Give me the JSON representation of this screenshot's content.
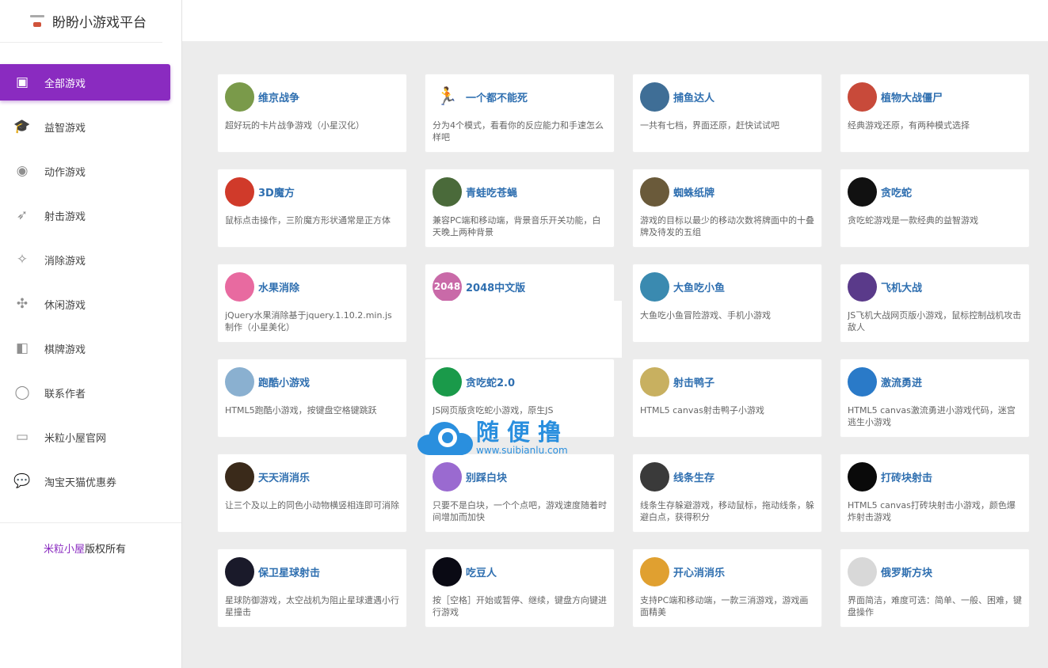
{
  "brand": {
    "title": "盼盼小游戏平台",
    "logo_icon": "site-logo-icon"
  },
  "sidebar": {
    "items": [
      {
        "label": "全部游戏",
        "icon": "twitch-icon",
        "glyph": "▣",
        "active": true
      },
      {
        "label": "益智游戏",
        "icon": "graduation-cap-icon",
        "glyph": "🎓",
        "active": false
      },
      {
        "label": "动作游戏",
        "icon": "reddit-icon",
        "glyph": "◉",
        "active": false
      },
      {
        "label": "射击游戏",
        "icon": "rocket-icon",
        "glyph": "➶",
        "active": false
      },
      {
        "label": "消除游戏",
        "icon": "puzzle-icon",
        "glyph": "✧",
        "active": false
      },
      {
        "label": "休闲游戏",
        "icon": "pinwheel-icon",
        "glyph": "✣",
        "active": false
      },
      {
        "label": "棋牌游戏",
        "icon": "grid-icon",
        "glyph": "◧",
        "active": false
      },
      {
        "label": "联系作者",
        "icon": "user-icon",
        "glyph": "◯",
        "active": false
      },
      {
        "label": "米粒小屋官网",
        "icon": "laptop-icon",
        "glyph": "▭",
        "active": false
      },
      {
        "label": "淘宝天猫优惠券",
        "icon": "chat-bubble-icon",
        "glyph": "💬",
        "active": false
      }
    ],
    "footer": {
      "link": "米粒小屋",
      "text": "版权所有"
    }
  },
  "games": [
    {
      "title": "维京战争",
      "desc": "超好玩的卡片战争游戏（小星汉化）",
      "icon_color": "#7a9a4a",
      "badge": ""
    },
    {
      "title": "一个都不能死",
      "desc": "分为4个模式，看看你的反应能力和手速怎么样吧",
      "icon_color": "#ffffff",
      "badge": ""
    },
    {
      "title": "捕鱼达人",
      "desc": "一共有七档，界面还原，赶快试试吧",
      "icon_color": "#3f6e96",
      "badge": ""
    },
    {
      "title": "植物大战僵尸",
      "desc": "经典游戏还原，有两种模式选择",
      "icon_color": "#c84a3a",
      "badge": ""
    },
    {
      "title": "3D魔方",
      "desc": "鼠标点击操作，三阶魔方形状通常是正方体",
      "icon_color": "#d03a2a",
      "badge": ""
    },
    {
      "title": "青蛙吃苍蝇",
      "desc": "兼容PC端和移动端，背景音乐开关功能，白天晚上两种背景",
      "icon_color": "#4a6a3a",
      "badge": ""
    },
    {
      "title": "蜘蛛纸牌",
      "desc": "游戏的目标以最少的移动次数将牌面中的十叠牌及待发的五组",
      "icon_color": "#6a5a3a",
      "badge": ""
    },
    {
      "title": "贪吃蛇",
      "desc": "贪吃蛇游戏是一款经典的益智游戏",
      "icon_color": "#111111",
      "badge": ""
    },
    {
      "title": "水果消除",
      "desc": "jQuery水果消除基于jquery.1.10.2.min.js制作（小星美化）",
      "icon_color": "#e86aa0",
      "badge": ""
    },
    {
      "title": "2048中文版",
      "desc": "",
      "icon_color": "#c96aa8",
      "badge": "2048"
    },
    {
      "title": "大鱼吃小鱼",
      "desc": "大鱼吃小鱼冒险游戏、手机小游戏",
      "icon_color": "#3a8ab0",
      "badge": ""
    },
    {
      "title": "飞机大战",
      "desc": "JS飞机大战网页版小游戏，鼠标控制战机攻击敌人",
      "icon_color": "#5a3a8a",
      "badge": ""
    },
    {
      "title": "跑酷小游戏",
      "desc": "HTML5跑酷小游戏，按键盘空格键跳跃",
      "icon_color": "#8ab0d0",
      "badge": ""
    },
    {
      "title": "贪吃蛇2.0",
      "desc": "JS网页版贪吃蛇小游戏，原生JS",
      "icon_color": "#1a9a4a",
      "badge": ""
    },
    {
      "title": "射击鸭子",
      "desc": "HTML5 canvas射击鸭子小游戏",
      "icon_color": "#c8b060",
      "badge": ""
    },
    {
      "title": "激流勇进",
      "desc": "HTML5 canvas激流勇进小游戏代码，迷宫逃生小游戏",
      "icon_color": "#2a7ac8",
      "badge": ""
    },
    {
      "title": "天天消消乐",
      "desc": "让三个及以上的同色小动物横竖相连即可消除",
      "icon_color": "#3a2a1a",
      "badge": ""
    },
    {
      "title": "别踩白块",
      "desc": "只要不是白块，一个个点吧，游戏速度随着时间增加而加快",
      "icon_color": "#9a6ad0",
      "badge": ""
    },
    {
      "title": "线条生存",
      "desc": "线条生存躲避游戏，移动鼠标，拖动线条，躲避白点，获得积分",
      "icon_color": "#3a3a3a",
      "badge": ""
    },
    {
      "title": "打砖块射击",
      "desc": "HTML5 canvas打砖块射击小游戏，颜色爆炸射击游戏",
      "icon_color": "#0a0a0a",
      "badge": ""
    },
    {
      "title": "保卫星球射击",
      "desc": "星球防御游戏，太空战机为阻止星球遭遇小行星撞击",
      "icon_color": "#1a1a2a",
      "badge": ""
    },
    {
      "title": "吃豆人",
      "desc": "按［空格］开始或暂停、继续，键盘方向键进行游戏",
      "icon_color": "#0a0a14",
      "badge": ""
    },
    {
      "title": "开心消消乐",
      "desc": "支持PC端和移动端，一款三消游戏，游戏画面精美",
      "icon_color": "#e0a030",
      "badge": ""
    },
    {
      "title": "俄罗斯方块",
      "desc": "界面简洁，难度可选：简单、一般、困难，键盘操作",
      "icon_color": "#d8d8d8",
      "badge": ""
    }
  ],
  "watermark": {
    "big": "随便撸",
    "small": "www.suibianlu.com"
  },
  "colors": {
    "accent": "#8a2bc0",
    "link": "#2f6fb0",
    "watermark": "#2a8fde"
  }
}
